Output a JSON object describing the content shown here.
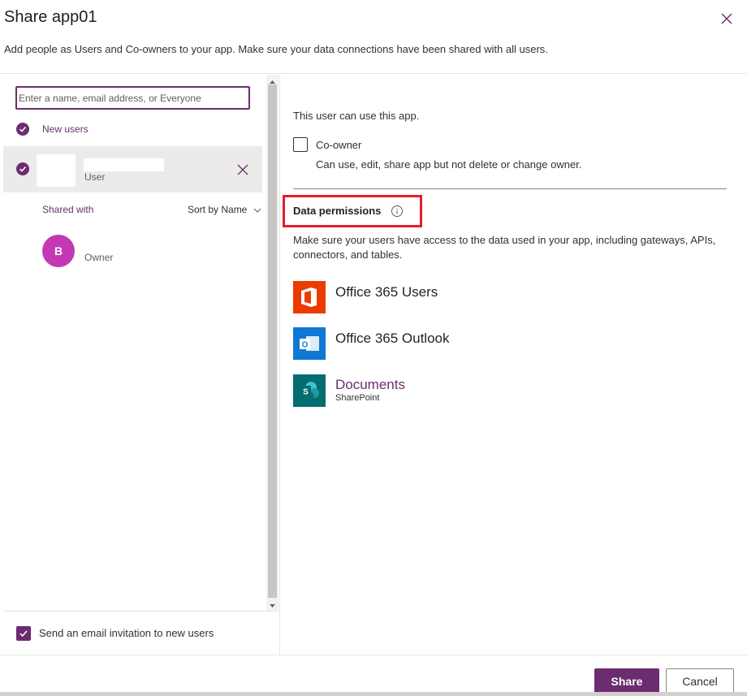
{
  "dialog": {
    "title": "Share app01",
    "subtitle": "Add people as Users and Co-owners to your app. Make sure your data connections have been shared with all users.",
    "close_icon": "close-icon"
  },
  "left": {
    "search_placeholder": "Enter a name, email address, or Everyone",
    "new_users_label": "New users",
    "new_user": {
      "role": "User"
    },
    "shared_with_label": "Shared with",
    "sort_label": "Sort by Name",
    "owner": {
      "initial": "B",
      "role": "Owner",
      "avatar_color": "#c239b3"
    },
    "email_invite_label": "Send an email invitation to new users",
    "email_invite_checked": true
  },
  "right": {
    "use_app_text": "This user can use this app.",
    "coowner_label": "Co-owner",
    "coowner_desc": "Can use, edit, share app but not delete or change owner.",
    "coowner_checked": false,
    "data_permissions_title": "Data permissions",
    "data_permissions_desc": "Make sure your users have access to the data used in your app, including gateways, APIs, connectors, and tables.",
    "data_sources": [
      {
        "name": "Office 365 Users",
        "sub": "",
        "icon": "office-icon",
        "color": "#eb3c00"
      },
      {
        "name": "Office 365 Outlook",
        "sub": "",
        "icon": "outlook-icon",
        "color": "#0f78d4"
      },
      {
        "name": "Documents",
        "sub": "SharePoint",
        "icon": "sharepoint-icon",
        "color": "#036c70"
      }
    ]
  },
  "footer": {
    "share_label": "Share",
    "cancel_label": "Cancel"
  },
  "colors": {
    "accent": "#6b2d6f",
    "highlight": "#e01e2e"
  }
}
